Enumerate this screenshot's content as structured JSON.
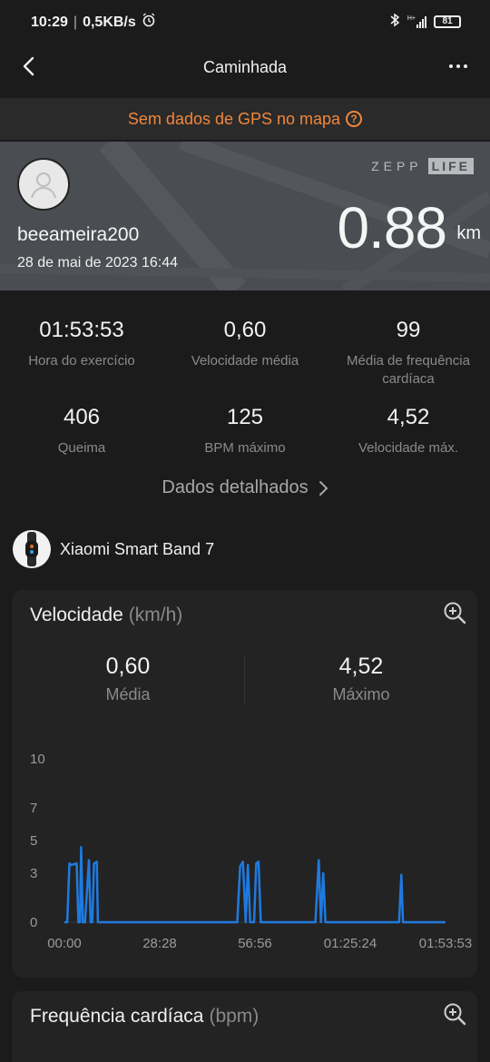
{
  "status_bar": {
    "time": "10:29",
    "network_speed": "0,5KB/s",
    "network_type": "H+",
    "battery": "81"
  },
  "nav": {
    "title": "Caminhada"
  },
  "gps_banner": {
    "text": "Sem dados de GPS no mapa"
  },
  "profile": {
    "username": "beeameira200",
    "datetime": "28 de mai de 2023 16:44",
    "brand_left": "ZEPP",
    "brand_right": "LIFE",
    "distance": "0.88",
    "distance_unit": "km"
  },
  "stats": [
    {
      "value": "01:53:53",
      "label": "Hora do exercício"
    },
    {
      "value": "0,60",
      "label": "Velocidade média"
    },
    {
      "value": "99",
      "label": "Média de frequência cardíaca"
    },
    {
      "value": "406",
      "label": "Queima"
    },
    {
      "value": "125",
      "label": "BPM máximo"
    },
    {
      "value": "4,52",
      "label": "Velocidade máx."
    }
  ],
  "detailed_link": "Dados detalhados",
  "device": {
    "name": "Xiaomi Smart Band 7"
  },
  "speed_card": {
    "title": "Velocidade",
    "unit": "(km/h)",
    "avg_value": "0,60",
    "avg_label": "Média",
    "max_value": "4,52",
    "max_label": "Máximo"
  },
  "heart_card": {
    "title": "Frequência cardíaca",
    "unit": "(bpm)"
  },
  "colors": {
    "accent": "#f0873b",
    "series": "#1f7ae0"
  },
  "chart_data": {
    "type": "line",
    "title": "",
    "xlabel": "",
    "ylabel": "",
    "y_ticks": [
      0,
      3,
      5,
      7,
      10
    ],
    "ylim": [
      0,
      10
    ],
    "x_ticks": [
      "00:00",
      "28:28",
      "56:56",
      "01:25:24",
      "01:53:53"
    ],
    "xlim": [
      0,
      6833
    ],
    "series": [
      {
        "values_x": [
          0,
          50,
          90,
          120,
          220,
          250,
          280,
          300,
          330,
          370,
          440,
          470,
          500,
          530,
          580,
          600,
          660,
          700,
          760,
          900,
          1100,
          2800,
          3100,
          3150,
          3200,
          3250,
          3290,
          3330,
          3370,
          3400,
          3440,
          3480,
          3520,
          3560,
          3610,
          3640,
          3680,
          3720,
          3760,
          4000,
          4500,
          4560,
          4600,
          4640,
          4680,
          4720,
          4760,
          4780,
          4900,
          6000,
          6040,
          6070,
          6100,
          6150,
          6833
        ],
        "values_y": [
          0,
          0,
          3.6,
          3.5,
          3.6,
          0,
          0,
          4.6,
          0,
          0,
          3.8,
          0,
          0,
          3.6,
          3.7,
          0,
          0,
          0,
          0,
          0,
          0,
          0,
          0,
          3.4,
          3.7,
          0,
          3.5,
          0,
          0,
          0,
          3.6,
          3.7,
          0,
          0,
          0,
          0,
          0,
          0,
          0,
          0,
          0,
          3.8,
          0,
          3.0,
          0,
          0,
          0,
          0,
          0,
          0,
          2.9,
          0,
          0,
          0,
          0
        ]
      }
    ]
  }
}
